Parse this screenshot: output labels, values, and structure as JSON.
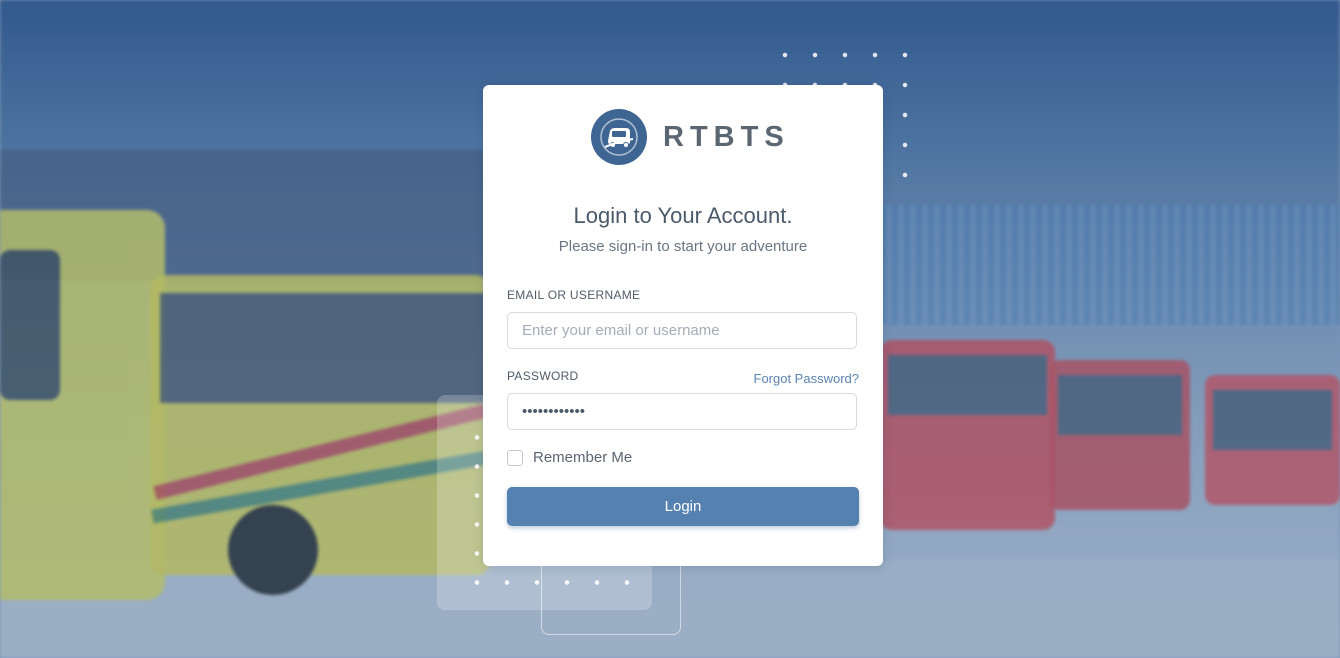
{
  "brand": {
    "name": "RTBTS",
    "logo_icon": "bus-logo-icon"
  },
  "login": {
    "title": "Login to Your Account.",
    "subtitle": "Please sign-in to start your adventure",
    "email_label": "EMAIL OR USERNAME",
    "email_placeholder": "Enter your email or username",
    "email_value": "",
    "password_label": "PASSWORD",
    "password_value": "••••••••••••",
    "forgot_password": "Forgot Password?",
    "remember_me": "Remember Me",
    "remember_checked": false,
    "submit_label": "Login"
  },
  "colors": {
    "accent": "#5581b0",
    "logo_bg": "#3f6693",
    "text": "#4b5a6b"
  }
}
